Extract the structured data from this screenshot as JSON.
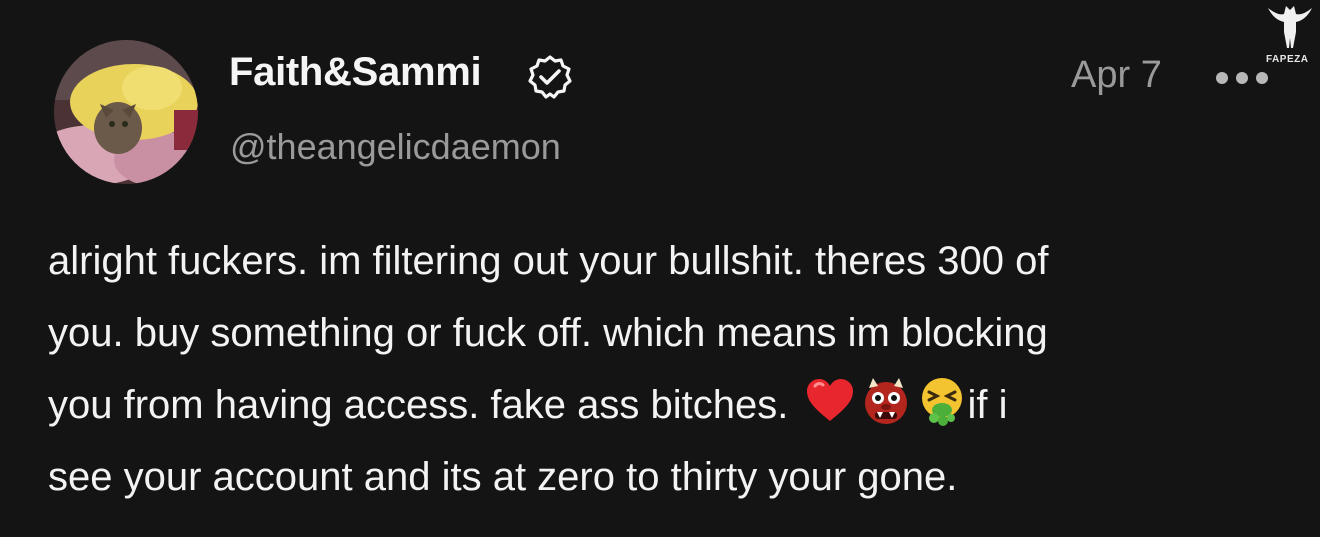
{
  "post": {
    "author": {
      "display_name": "Faith&Sammi",
      "handle": "@theangelicdaemon",
      "verified": true
    },
    "timestamp": "Apr 7",
    "text_lines": [
      "alright fuckers. im filtering out your bullshit. theres 300 of",
      "you. buy something or fuck off. which means im blocking",
      "you from having access. fake ass bitches.",
      "if i",
      "see your account and its at zero to thirty your gone."
    ],
    "emojis": [
      "red-heart-emoji",
      "ogre-emoji",
      "vomiting-face-emoji"
    ]
  },
  "watermark": {
    "text": "FAPEZA"
  },
  "icons": {
    "verified": "verified-badge-icon",
    "more": "more-options-icon"
  },
  "colors": {
    "background": "#141414",
    "primary_text": "#f3f3f3",
    "secondary_text": "#9a9a9a"
  }
}
